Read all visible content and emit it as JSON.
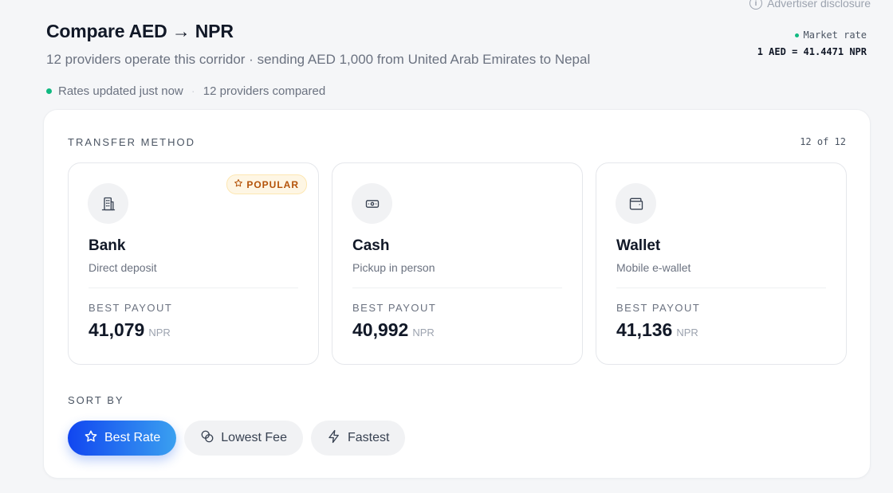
{
  "disclosure": {
    "label": "Advertiser disclosure",
    "icon": "info-icon"
  },
  "header": {
    "title": "Compare AED → NPR",
    "subtitle": "12 providers operate this corridor · sending AED 1,000 from United Arab Emirates to Nepal",
    "status_updated": "Rates updated just now",
    "status_sep": "·",
    "status_compared": "12 providers compared"
  },
  "market": {
    "label": "Market rate",
    "rate": "1 AED = 41.4471 NPR"
  },
  "transfer": {
    "section_label": "TRANSFER METHOD",
    "count": "12 of 12",
    "payout_label": "BEST PAYOUT",
    "cards": [
      {
        "name": "Bank",
        "desc": "Direct deposit",
        "value": "41,079",
        "unit": "NPR",
        "icon": "bank-icon",
        "badge": "POPULAR"
      },
      {
        "name": "Cash",
        "desc": "Pickup in person",
        "value": "40,992",
        "unit": "NPR",
        "icon": "cash-icon"
      },
      {
        "name": "Wallet",
        "desc": "Mobile e-wallet",
        "value": "41,136",
        "unit": "NPR",
        "icon": "wallet-icon"
      }
    ]
  },
  "sort": {
    "label": "SORT BY",
    "options": [
      {
        "label": "Best Rate",
        "icon": "star-icon",
        "active": true
      },
      {
        "label": "Lowest Fee",
        "icon": "coins-icon",
        "active": false
      },
      {
        "label": "Fastest",
        "icon": "lightning-icon",
        "active": false
      }
    ]
  },
  "colors": {
    "accent": "#1146f0",
    "status_green": "#10b981",
    "badge_text": "#b45309"
  }
}
